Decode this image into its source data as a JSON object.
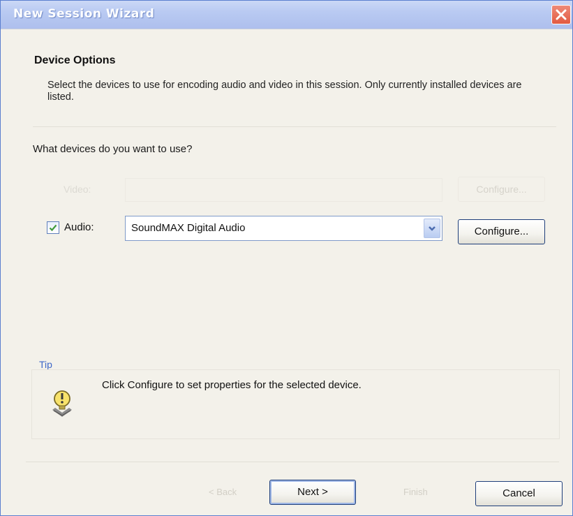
{
  "window": {
    "title": "New Session Wizard"
  },
  "header": {
    "title": "Device Options",
    "description": "Select the devices to use for encoding audio and video in this session. Only currently installed devices are listed."
  },
  "main": {
    "question": "What devices do you want to use?",
    "video": {
      "label": "Video:",
      "enabled": false,
      "configure_label": "Configure..."
    },
    "audio": {
      "label": "Audio:",
      "checked": true,
      "selected_device": "SoundMAX Digital Audio",
      "configure_label": "Configure..."
    }
  },
  "tip": {
    "label": "Tip",
    "text": "Click Configure to set properties for the selected device."
  },
  "footer": {
    "back_label": "< Back",
    "next_label": "Next >",
    "finish_label": "Finish",
    "cancel_label": "Cancel"
  },
  "colors": {
    "title_bar": "#b9caf2",
    "close_button": "#e25a41",
    "tip_label": "#3f68c8",
    "window_bg": "#f3f1ea"
  },
  "icons": [
    "close-icon",
    "check-icon",
    "chevron-down-icon",
    "tip-lightbulb-icon"
  ]
}
